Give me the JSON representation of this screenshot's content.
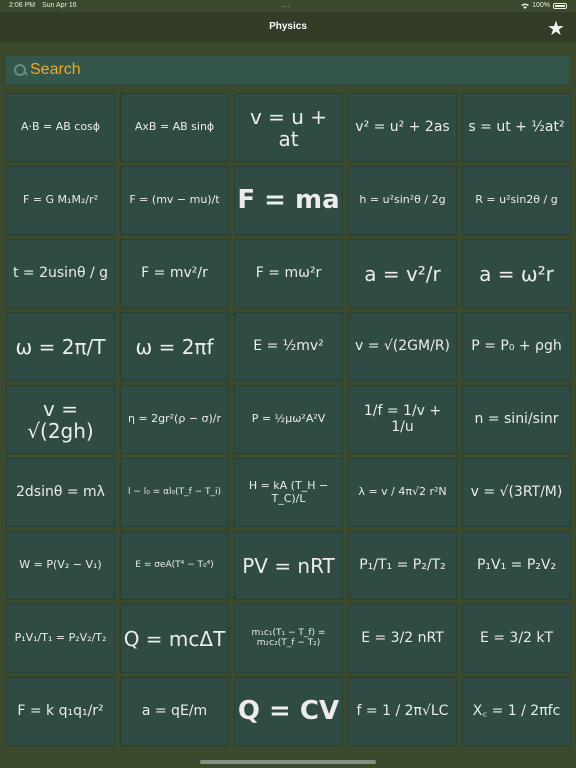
{
  "status": {
    "time": "2:06 PM",
    "date": "Sun Apr 16",
    "dots": "...",
    "battery": "100%",
    "wifi_icon": "wifi-icon",
    "battery_icon": "battery-icon"
  },
  "nav": {
    "title": "Physics",
    "favorite_icon": "star-icon",
    "favorite_glyph": "★"
  },
  "search": {
    "placeholder": "Search",
    "icon": "search-icon"
  },
  "formulas": [
    "A·B = AB cosϕ",
    "AxB = AB sinϕ",
    "v = u + at",
    "v² = u² + 2as",
    "s = ut + ½at²",
    "F = G M₁M₂/r²",
    "F = (mv − mu)/t",
    "F = ma",
    "h = u²sin²θ / 2g",
    "R = u²sin2θ / g",
    "t = 2usinθ / g",
    "F = mv²/r",
    "F = mω²r",
    "a = v²/r",
    "a = ω²r",
    "ω = 2π/T",
    "ω = 2πf",
    "E = ½mv²",
    "v = √(2GM/R)",
    "P = P₀ + ρgh",
    "v = √(2gh)",
    "η = 2gr²(ρ − σ)/r",
    "P = ½μω²A²V",
    "1/f = 1/v + 1/u",
    "n = sini/sinr",
    "2dsinθ = mλ",
    "l − l₀ = αl₀(T_f − T_i)",
    "H = kA (T_H − T_C)/L",
    "λ = v / 4π√2 r²N",
    "v = √(3RT/M)",
    "W = P(V₂ − V₁)",
    "E = σeA(T⁴ − T₀⁴)",
    "PV = nRT",
    "P₁/T₁ = P₂/T₂",
    "P₁V₁ = P₂V₂",
    "P₁V₁/T₁ = P₂V₂/T₂",
    "Q = mcΔT",
    "m₁c₁(T₁ − T_f) = m₂c₂(T_f − T₂)",
    "E = 3/2 nRT",
    "E = 3/2 kT",
    "F = k q₁q₁/r²",
    "a = qE/m",
    "Q = CV",
    "f = 1 / 2π√LC",
    "X꜀ = 1 / 2πfc"
  ]
}
